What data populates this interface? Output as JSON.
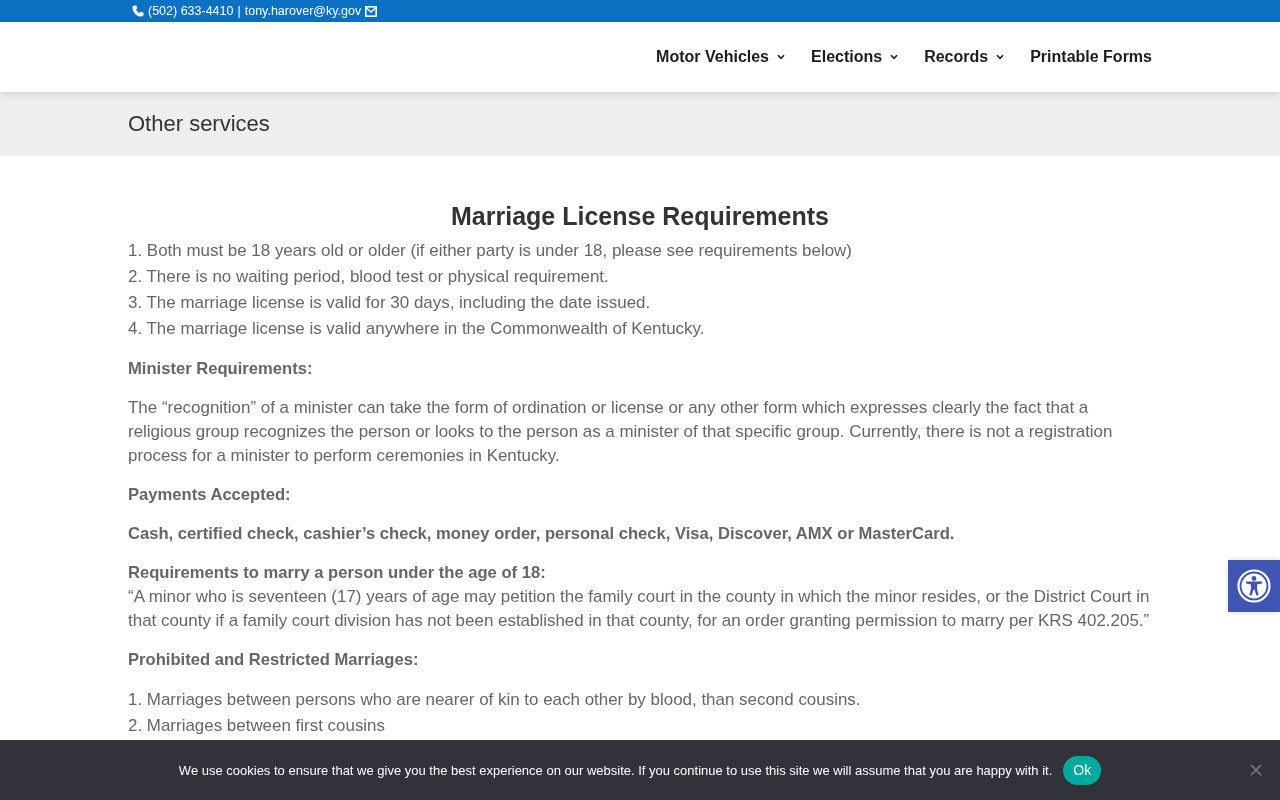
{
  "top_bar": {
    "phone": "(502) 633-4410",
    "separator": "|",
    "email": "tony.harover@ky.gov"
  },
  "nav": {
    "items": [
      {
        "label": "Motor Vehicles",
        "has_menu": true
      },
      {
        "label": "Elections",
        "has_menu": true
      },
      {
        "label": "Records",
        "has_menu": true
      },
      {
        "label": "Printable Forms",
        "has_menu": false
      }
    ]
  },
  "title_bar": {
    "title": "Other services"
  },
  "content": {
    "heading": "Marriage License Requirements",
    "blocks": [
      {
        "kind": "list",
        "items": [
          "1. Both must be 18 years old or older (if either party is under 18, please see requirements below)",
          "2. There is no waiting period, blood test or physical requirement.",
          "3. The marriage license is valid for 30 days, including the date issued.",
          "4. The marriage license is valid anywhere in the Commonwealth of Kentucky."
        ]
      },
      {
        "kind": "label",
        "text": "Minister Requirements:"
      },
      {
        "kind": "paragraph",
        "text": "The “recognition” of a minister can take the form of ordination or license or any other form which expresses clearly the fact that a religious group recognizes the person or looks to the person as a minister of that specific group. Currently, there is not a registration process for a minister to perform ceremonies in Kentucky."
      },
      {
        "kind": "label",
        "text": "Payments Accepted:"
      },
      {
        "kind": "label",
        "text": "Cash, certified check, cashier’s check, money order, personal check, Visa, Discover, AMX or MasterCard."
      },
      {
        "kind": "labeled_paragraph",
        "label": "Requirements to marry a person under the age of 18:",
        "text": "“A minor who is seventeen (17) years of age may petition the family court in the county in which the minor resides, or the District Court in that county if a family court division has not been established in that county, for an order granting permission to marry per KRS 402.205.”"
      },
      {
        "kind": "label",
        "text": "Prohibited and Restricted Marriages:"
      },
      {
        "kind": "list",
        "items": [
          "1. Marriages between persons who are nearer of kin to each other by blood, than second cousins.",
          "2. Marriages between first cousins"
        ]
      }
    ]
  },
  "cookie_bar": {
    "message": "We use cookies to ensure that we give you the best experience on our website. If you continue to use this site we will assume that you are happy with it.",
    "button": "Ok"
  }
}
